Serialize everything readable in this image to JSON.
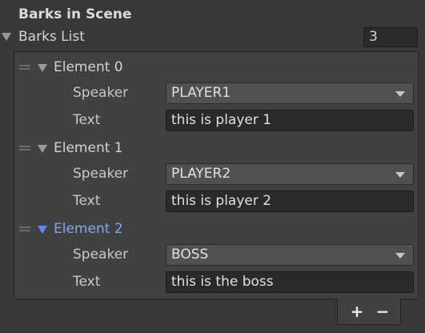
{
  "section": {
    "title": "Barks in Scene"
  },
  "list": {
    "label": "Barks List",
    "count": "3",
    "elements": [
      {
        "label": "Element 0",
        "speaker_label": "Speaker",
        "speaker": "PLAYER1",
        "text_label": "Text",
        "text": "this is player 1"
      },
      {
        "label": "Element 1",
        "speaker_label": "Speaker",
        "speaker": "PLAYER2",
        "text_label": "Text",
        "text": "this is player 2"
      },
      {
        "label": "Element 2",
        "speaker_label": "Speaker",
        "speaker": "BOSS",
        "text_label": "Text",
        "text": "this is the boss"
      }
    ]
  },
  "footer": {
    "add_label": "+",
    "remove_label": "−"
  },
  "icons": {
    "foldout": "triangle-down-icon",
    "handle": "drag-handle-icon",
    "dropdown": "chevron-down-icon"
  },
  "colors": {
    "background": "#383838",
    "panel": "#414141",
    "field": "#2a2a2a",
    "dropdown": "#515151",
    "selected": "#7fa8f2"
  }
}
